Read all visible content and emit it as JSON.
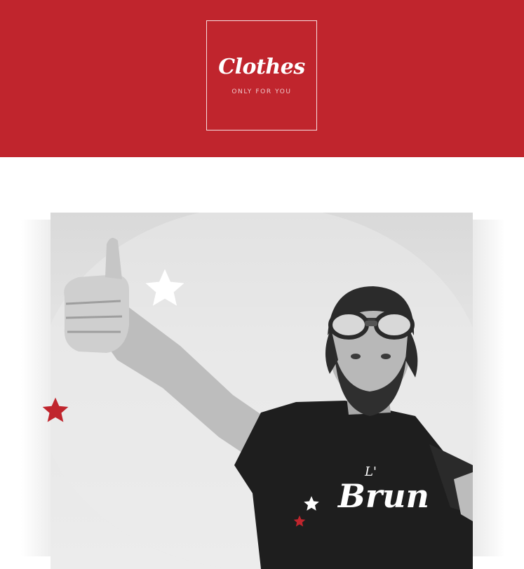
{
  "brand": {
    "name": "Clothes",
    "tagline": "ONLY FOR YOU"
  },
  "hero": {
    "shirt_text_small": "L'",
    "shirt_text_large": "Brun"
  },
  "colors": {
    "brand_red": "#c0252d",
    "shirt": "#1e1e1e",
    "background": "#ffffff"
  },
  "icons": [
    "star-icon-white",
    "star-icon-red"
  ]
}
